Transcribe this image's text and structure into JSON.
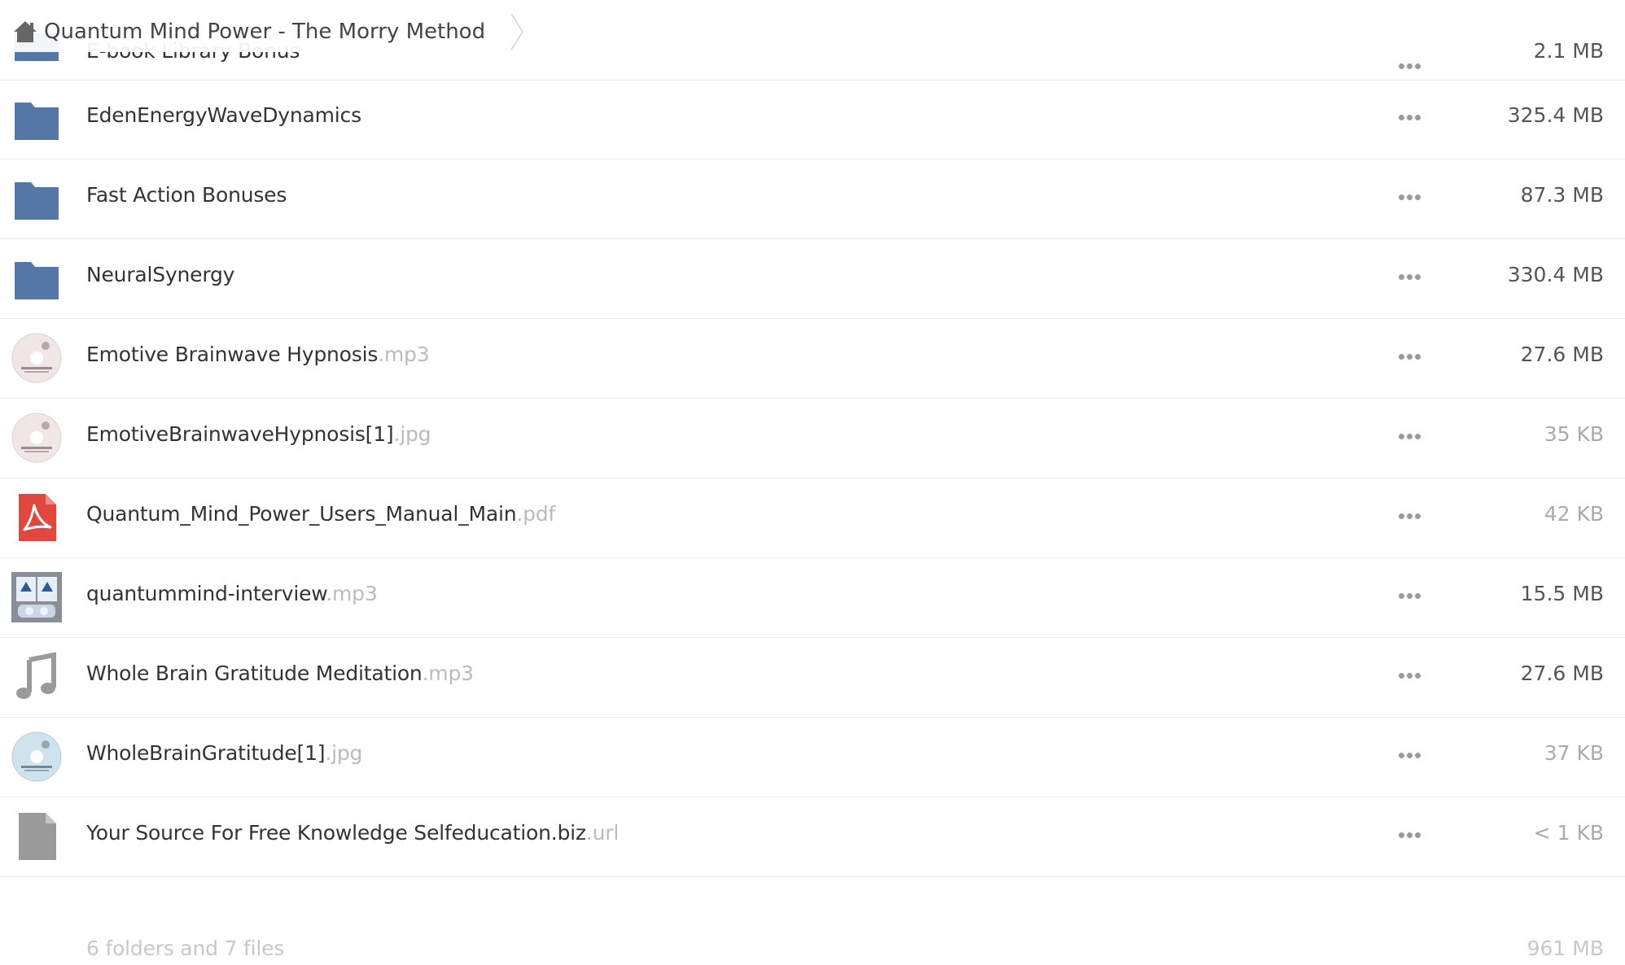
{
  "breadcrumb": {
    "title": "Quantum Mind Power - The Morry Method"
  },
  "files": [
    {
      "name": "E-book Library Bonus",
      "ext": "",
      "size": "2.1 MB",
      "icon": "folder-icon"
    },
    {
      "name": "EdenEnergyWaveDynamics",
      "ext": "",
      "size": "325.4 MB",
      "icon": "folder-icon"
    },
    {
      "name": "Fast Action Bonuses",
      "ext": "",
      "size": "87.3 MB",
      "icon": "folder-icon"
    },
    {
      "name": "NeuralSynergy",
      "ext": "",
      "size": "330.4 MB",
      "icon": "folder-icon"
    },
    {
      "name": "Emotive Brainwave Hypnosis",
      "ext": ".mp3",
      "size": "27.6 MB",
      "icon": "cd-thumbnail-icon"
    },
    {
      "name": "EmotiveBrainwaveHypnosis[1]",
      "ext": ".jpg",
      "size": "35 KB",
      "icon": "cd-thumbnail-icon"
    },
    {
      "name": "Quantum_Mind_Power_Users_Manual_Main",
      "ext": ".pdf",
      "size": "42 KB",
      "icon": "pdf-icon"
    },
    {
      "name": "quantummind-interview",
      "ext": ".mp3",
      "size": "15.5 MB",
      "icon": "album-art-icon"
    },
    {
      "name": "Whole Brain Gratitude Meditation",
      "ext": ".mp3",
      "size": "27.6 MB",
      "icon": "music-note-icon"
    },
    {
      "name": "WholeBrainGratitude[1]",
      "ext": ".jpg",
      "size": "37 KB",
      "icon": "cd-thumbnail-blue-icon"
    },
    {
      "name": "Your Source For Free Knowledge Selfeducation.biz",
      "ext": ".url",
      "size": "< 1 KB",
      "icon": "file-icon"
    }
  ],
  "summary": {
    "text": "6 folders and 7 files",
    "size": "961 MB"
  },
  "colors": {
    "folder": "#5577a8",
    "pdf": "#e2473f",
    "ext": "#bbbbbb",
    "grey_icon": "#9a9a9a"
  }
}
